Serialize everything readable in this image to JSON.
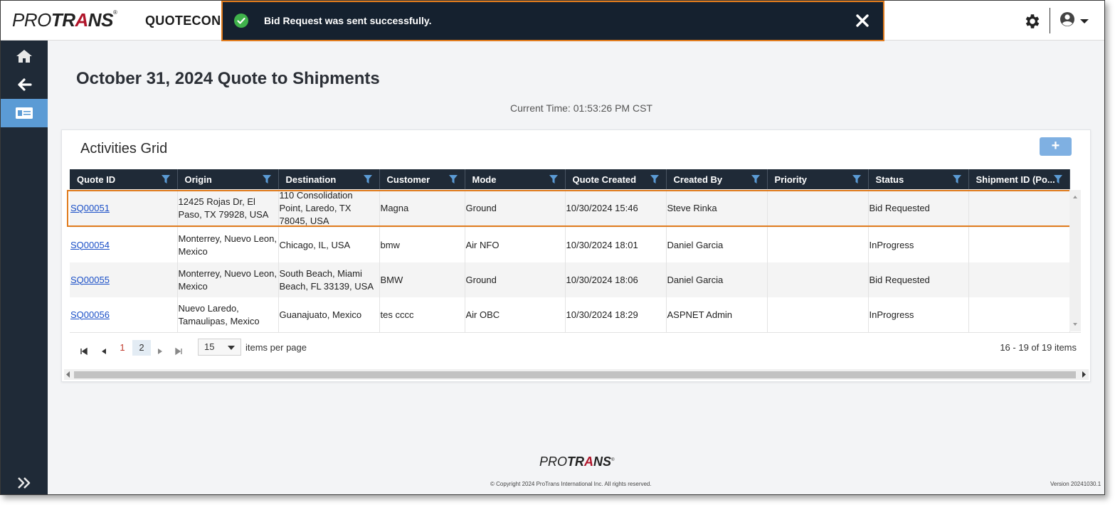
{
  "header": {
    "logo": {
      "pre": "PRO",
      "mid": "TR",
      "accent": "A",
      "post": "NS",
      "reg": "®"
    },
    "app_name": "QUOTECONNI"
  },
  "toast": {
    "message": "Bid Request was sent successfully.",
    "icons": {
      "status": "check-circle-icon",
      "close": "close-icon"
    }
  },
  "sidebar": {
    "items": [
      {
        "name": "home",
        "icon": "home-icon"
      },
      {
        "name": "back",
        "icon": "arrow-left-icon"
      },
      {
        "name": "quotes",
        "icon": "quote-card-icon",
        "active": true
      }
    ],
    "expand_icon": "double-chevron-right-icon"
  },
  "page": {
    "title": "October 31, 2024 Quote to Shipments",
    "current_time": "Current Time: 01:53:26 PM CST"
  },
  "grid": {
    "title": "Activities Grid",
    "add_label": "+",
    "columns": [
      "Quote ID",
      "Origin",
      "Destination",
      "Customer",
      "Mode",
      "Quote Created",
      "Created By",
      "Priority",
      "Status",
      "Shipment ID (Po..."
    ],
    "rows": [
      {
        "quote_id": "SQ00051",
        "origin": "12425 Rojas Dr, El Paso, TX 79928, USA",
        "destination": "110 Consolidation Point, Laredo, TX 78045, USA",
        "customer": "Magna",
        "mode": "Ground",
        "created": "10/30/2024 15:46",
        "created_by": "Steve Rinka",
        "priority": "",
        "status": "Bid Requested",
        "shipment_id": ""
      },
      {
        "quote_id": "SQ00054",
        "origin": "Monterrey, Nuevo Leon, Mexico",
        "destination": "Chicago, IL, USA",
        "customer": "bmw",
        "mode": "Air NFO",
        "created": "10/30/2024 18:01",
        "created_by": "Daniel Garcia",
        "priority": "",
        "status": "InProgress",
        "shipment_id": ""
      },
      {
        "quote_id": "SQ00055",
        "origin": "Monterrey, Nuevo Leon, Mexico",
        "destination": "South Beach, Miami Beach, FL 33139, USA",
        "customer": "BMW",
        "mode": "Ground",
        "created": "10/30/2024 18:06",
        "created_by": "Daniel Garcia",
        "priority": "",
        "status": "Bid Requested",
        "shipment_id": ""
      },
      {
        "quote_id": "SQ00056",
        "origin": "Nuevo Laredo, Tamaulipas, Mexico",
        "destination": "Guanajuato, Mexico",
        "customer": "tes cccc",
        "mode": "Air OBC",
        "created": "10/30/2024 18:29",
        "created_by": "ASPNET Admin",
        "priority": "",
        "status": "InProgress",
        "shipment_id": ""
      }
    ],
    "pager": {
      "pages": [
        "1",
        "2"
      ],
      "current_page": "2",
      "page_size": "15",
      "items_per_page_label": "items per page",
      "summary": "16 - 19 of 19 items"
    }
  },
  "footer": {
    "copyright": "© Copyright 2024 ProTrans International Inc. All rights reserved.",
    "version": "Version 20241030.1"
  },
  "colors": {
    "header_dark": "#1f2a37",
    "accent_orange": "#e07b1d",
    "link_blue": "#1a4fc7",
    "brand_red": "#b0152a",
    "success_green": "#3fb24b",
    "sidebar_active": "#5b9bd5"
  }
}
